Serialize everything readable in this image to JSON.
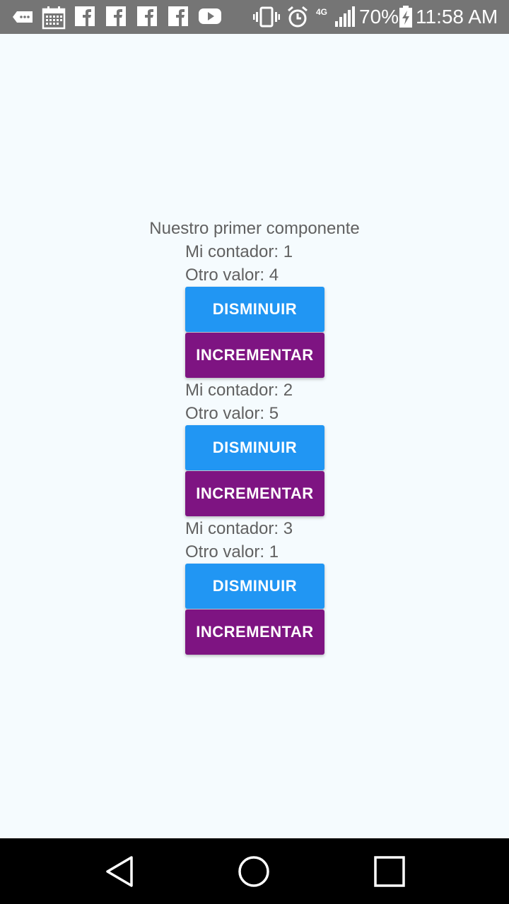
{
  "status_bar": {
    "battery_percent": "70%",
    "time": "11:58 AM",
    "network": "4G",
    "left_icons": [
      "message-icon",
      "calendar-icon",
      "facebook-icon",
      "facebook-icon",
      "facebook-icon",
      "facebook-icon",
      "youtube-icon"
    ],
    "right_icons": [
      "vibrate-icon",
      "alarm-icon",
      "signal-icon",
      "battery-icon"
    ]
  },
  "main": {
    "title": "Nuestro primer componente",
    "counters": [
      {
        "contador_label": "Mi contador: 1",
        "valor_label": "Otro valor: 4",
        "dec_label": "DISMINUIR",
        "inc_label": "INCREMENTAR"
      },
      {
        "contador_label": "Mi contador: 2",
        "valor_label": "Otro valor: 5",
        "dec_label": "DISMINUIR",
        "inc_label": "INCREMENTAR"
      },
      {
        "contador_label": "Mi contador: 3",
        "valor_label": "Otro valor: 1",
        "dec_label": "DISMINUIR",
        "inc_label": "INCREMENTAR"
      }
    ]
  },
  "colors": {
    "background": "#f5fbfe",
    "decrement": "#2196f3",
    "increment": "#7e1482",
    "text": "#616161",
    "status_bar": "#757575",
    "nav_bar": "#000000"
  },
  "nav_bar": {
    "icons": [
      "back-icon",
      "home-icon",
      "recents-icon"
    ]
  }
}
